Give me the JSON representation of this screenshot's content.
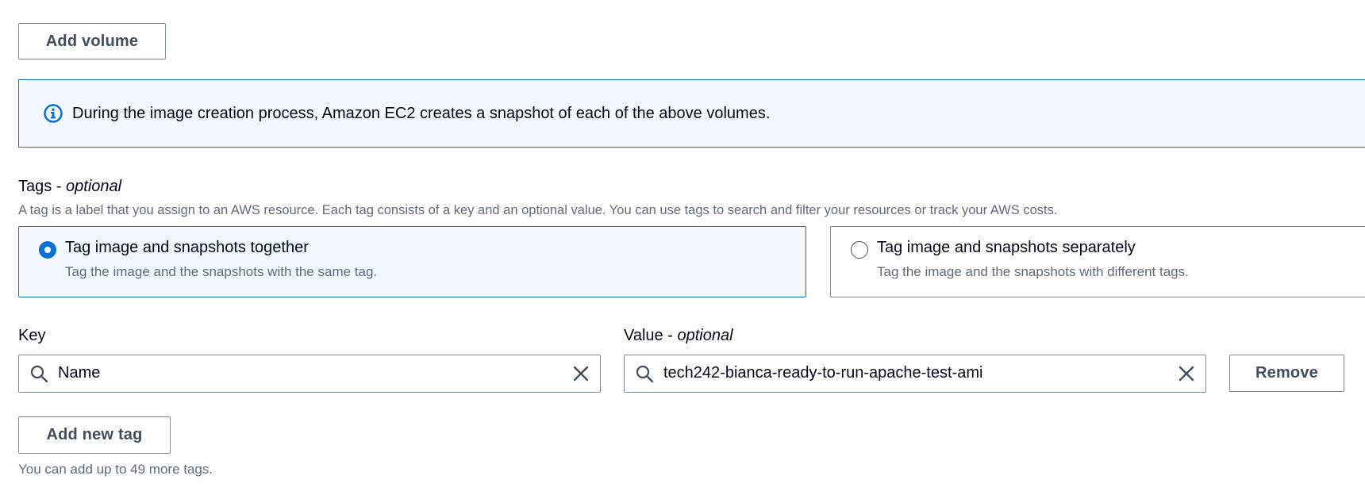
{
  "volume": {
    "add_volume_label": "Add volume"
  },
  "info_alert": {
    "icon": "info-icon",
    "text": "During the image creation process, Amazon EC2 creates a snapshot of each of the above volumes."
  },
  "tags": {
    "heading": "Tags - ",
    "heading_optional": "optional",
    "description": "A tag is a label that you assign to an AWS resource. Each tag consists of a key and an optional value. You can use tags to search and filter your resources or track your AWS costs.",
    "options": [
      {
        "title": "Tag image and snapshots together",
        "description": "Tag the image and the snapshots with the same tag.",
        "selected": true
      },
      {
        "title": "Tag image and snapshots separately",
        "description": "Tag the image and the snapshots with different tags.",
        "selected": false
      }
    ],
    "key_label": "Key",
    "value_label": "Value - ",
    "value_label_optional": "optional",
    "rows": [
      {
        "key": "Name",
        "value": "tech242-bianca-ready-to-run-apache-test-ami",
        "remove_label": "Remove"
      }
    ],
    "add_tag_label": "Add new tag",
    "hint": "You can add up to 49 more tags."
  },
  "colors": {
    "accent": "#0972d3",
    "info_bg": "#f2f8fd",
    "border": "#7d8998",
    "secondary_text": "#5f6b7a"
  }
}
